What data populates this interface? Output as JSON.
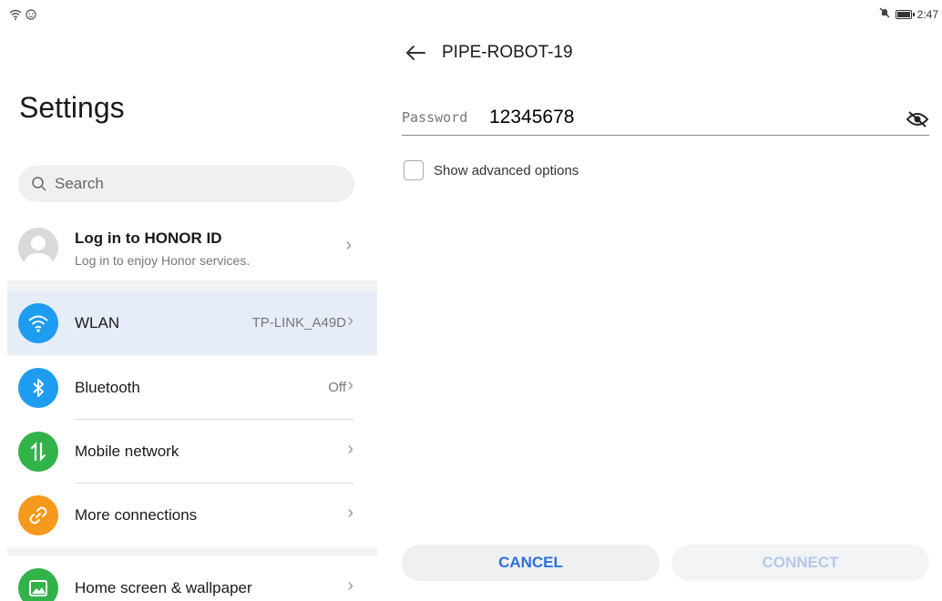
{
  "status_bar": {
    "time": "2:47"
  },
  "left": {
    "title": "Settings",
    "search_placeholder": "Search",
    "account": {
      "title": "Log in to HONOR ID",
      "subtitle": "Log in to enjoy Honor services."
    },
    "items": [
      {
        "label": "WLAN",
        "value": "TP-LINK_A49D",
        "icon": "wifi-icon",
        "color": "#1e9cf0"
      },
      {
        "label": "Bluetooth",
        "value": "Off",
        "icon": "bluetooth-icon",
        "color": "#1e9cf0"
      },
      {
        "label": "Mobile network",
        "value": "",
        "icon": "mobile-data-icon",
        "color": "#32b34a"
      },
      {
        "label": "More connections",
        "value": "",
        "icon": "link-icon",
        "color": "#f59a1c"
      },
      {
        "label": "Home screen & wallpaper",
        "value": "",
        "icon": "image-icon",
        "color": "#32b34a"
      }
    ]
  },
  "right": {
    "network_name": "PIPE-ROBOT-19",
    "password_label": "Password",
    "password_value": "12345678",
    "advanced_label": "Show advanced options",
    "cancel_label": "CANCEL",
    "connect_label": "CONNECT"
  },
  "colors": {
    "accent": "#2f6fe0",
    "selected_row": "#e6ecf8"
  }
}
